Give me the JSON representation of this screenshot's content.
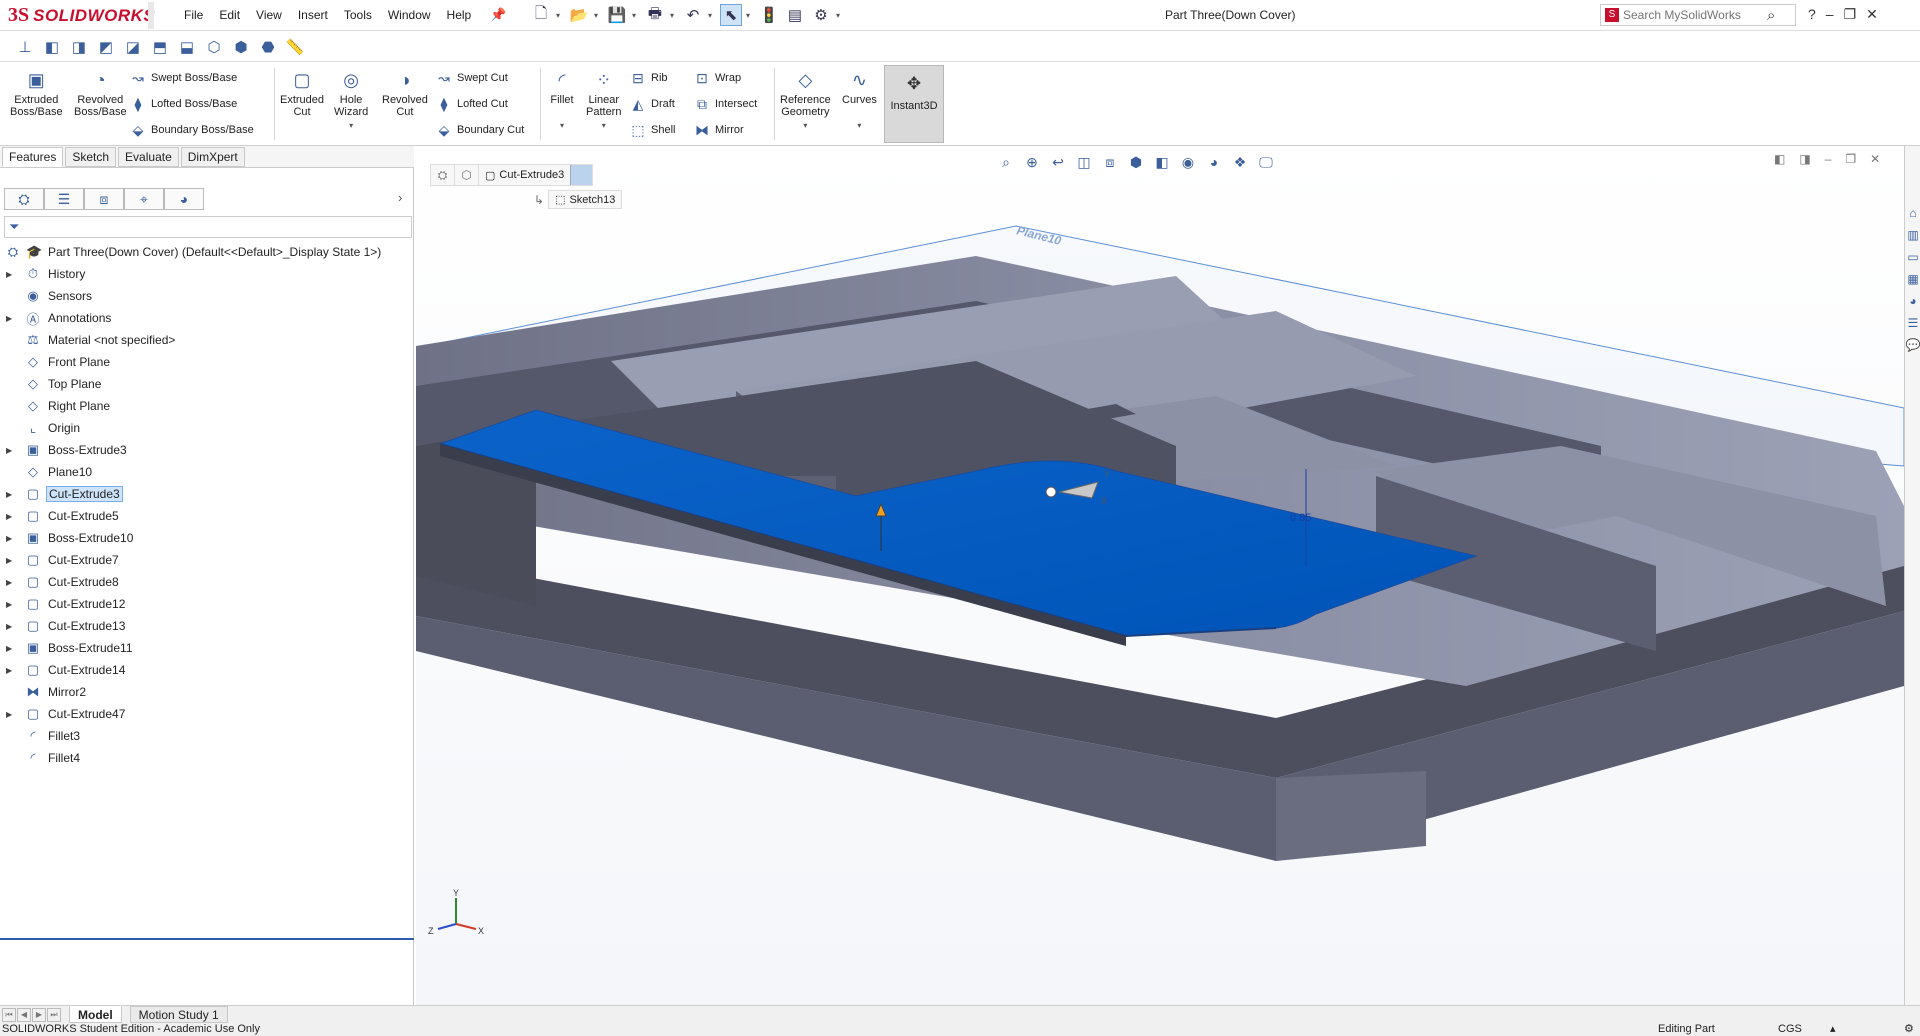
{
  "app": {
    "logo_ds": "3S",
    "logo_text": "SOLIDWORKS",
    "doc_title": "Part Three(Down Cover)"
  },
  "menu": [
    "File",
    "Edit",
    "View",
    "Insert",
    "Tools",
    "Window",
    "Help"
  ],
  "search": {
    "placeholder": "Search MySolidWorks"
  },
  "window_controls": [
    "?",
    "–",
    "❐",
    "✕"
  ],
  "command_manager": {
    "big": [
      {
        "label": "Extruded\nBoss/Base",
        "icon": "extruded-boss-icon"
      },
      {
        "label": "Revolved\nBoss/Base",
        "icon": "revolved-boss-icon"
      },
      {
        "label": "Extruded\nCut",
        "icon": "extruded-cut-icon"
      },
      {
        "label": "Hole\nWizard",
        "icon": "hole-wizard-icon"
      },
      {
        "label": "Revolved\nCut",
        "icon": "revolved-cut-icon"
      },
      {
        "label": "Fillet",
        "icon": "fillet-icon"
      },
      {
        "label": "Linear\nPattern",
        "icon": "linear-pattern-icon"
      },
      {
        "label": "Reference\nGeometry",
        "icon": "reference-geometry-icon"
      },
      {
        "label": "Curves",
        "icon": "curves-icon"
      }
    ],
    "small_boss": [
      "Swept Boss/Base",
      "Lofted Boss/Base",
      "Boundary Boss/Base"
    ],
    "small_cut": [
      "Swept Cut",
      "Lofted Cut",
      "Boundary Cut"
    ],
    "small_feat1": [
      "Rib",
      "Draft",
      "Shell"
    ],
    "small_feat2": [
      "Wrap",
      "Intersect",
      "Mirror"
    ],
    "instant3d": "Instant3D"
  },
  "tabs": [
    "Features",
    "Sketch",
    "Evaluate",
    "DimXpert"
  ],
  "tree": {
    "root": "Part Three(Down Cover)  (Default<<Default>_Display State 1>)",
    "items": [
      {
        "label": "History",
        "exp": true
      },
      {
        "label": "Sensors",
        "exp": false
      },
      {
        "label": "Annotations",
        "exp": true
      },
      {
        "label": "Material <not specified>",
        "exp": false
      },
      {
        "label": "Front Plane",
        "exp": false
      },
      {
        "label": "Top Plane",
        "exp": false
      },
      {
        "label": "Right Plane",
        "exp": false
      },
      {
        "label": "Origin",
        "exp": false
      },
      {
        "label": "Boss-Extrude3",
        "exp": true
      },
      {
        "label": "Plane10",
        "exp": false
      },
      {
        "label": "Cut-Extrude3",
        "exp": true,
        "selected": true
      },
      {
        "label": "Cut-Extrude5",
        "exp": true
      },
      {
        "label": "Boss-Extrude10",
        "exp": true
      },
      {
        "label": "Cut-Extrude7",
        "exp": true
      },
      {
        "label": "Cut-Extrude8",
        "exp": true
      },
      {
        "label": "Cut-Extrude12",
        "exp": true
      },
      {
        "label": "Cut-Extrude13",
        "exp": true
      },
      {
        "label": "Boss-Extrude11",
        "exp": true
      },
      {
        "label": "Cut-Extrude14",
        "exp": true
      },
      {
        "label": "Mirror2",
        "exp": false
      },
      {
        "label": "Cut-Extrude47",
        "exp": true
      },
      {
        "label": "Fillet3",
        "exp": false
      },
      {
        "label": "Fillet4",
        "exp": false
      }
    ]
  },
  "viewport": {
    "breadcrumb_feature": "Cut-Extrude3",
    "breadcrumb_sketch": "Sketch13",
    "plane_label": "Plane10",
    "dimension": "0.85",
    "triad": {
      "x": "X",
      "y": "Y",
      "z": "Z"
    }
  },
  "bottom_tabs": [
    "Model",
    "Motion Study 1"
  ],
  "status": {
    "left": "SOLIDWORKS Student Edition - Academic Use Only",
    "mode": "Editing Part",
    "units": "CGS"
  },
  "colors": {
    "accent": "#2a5db0",
    "selected_face": "#0a5fc4",
    "model_gray": "#8b8fa3",
    "brand": "#c8102e"
  }
}
